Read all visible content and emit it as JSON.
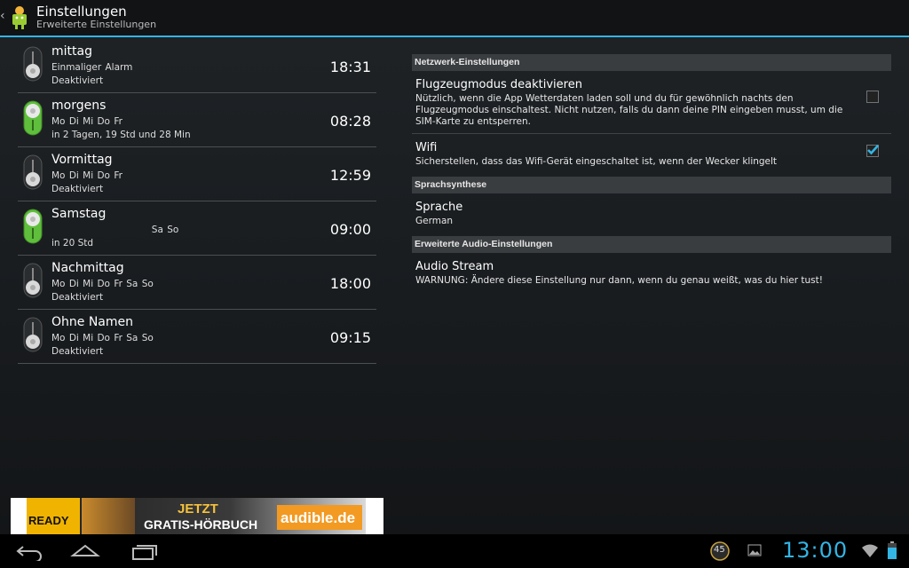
{
  "actionbar": {
    "title": "Einstellungen",
    "subtitle": "Erweiterte Einstellungen"
  },
  "alarms": [
    {
      "name": "mittag",
      "days": "Einmaliger Alarm",
      "status": "Deaktiviert",
      "time": "18:31",
      "enabled": false
    },
    {
      "name": "morgens",
      "days": "Mo Di Mi Do Fr",
      "status": "in 2 Tagen, 19 Std und 28 Min",
      "time": "08:28",
      "enabled": true
    },
    {
      "name": "Vormittag",
      "days": "Mo Di Mi Do Fr",
      "status": "Deaktiviert",
      "time": "12:59",
      "enabled": false
    },
    {
      "name": "Samstag",
      "days": "                          Sa So",
      "status": "in 20 Std",
      "time": "09:00",
      "enabled": true
    },
    {
      "name": "Nachmittag",
      "days": "Mo Di Mi Do Fr Sa So",
      "status": "Deaktiviert",
      "time": "18:00",
      "enabled": false
    },
    {
      "name": "Ohne Namen",
      "days": "Mo Di Mi Do Fr Sa So",
      "status": "Deaktiviert",
      "time": "09:15",
      "enabled": false
    }
  ],
  "ad": {
    "ready": "READY",
    "jetzt": "JETZT",
    "gratis": "GRATIS-HÖRBUCH",
    "brand": "audible.de"
  },
  "settings": {
    "network_header": "Netzwerk-Einstellungen",
    "airplane_title": "Flugzeugmodus deaktivieren",
    "airplane_summary": "Nützlich, wenn die App Wetterdaten laden soll und du für gewöhnlich nachts den Flugzeugmodus einschaltest. Nicht nutzen, falls du dann deine PIN eingeben musst, um die SIM-Karte zu entsperren.",
    "airplane_checked": false,
    "wifi_title": "Wifi",
    "wifi_summary": "Sicherstellen, dass das Wifi-Gerät eingeschaltet ist, wenn der Wecker klingelt",
    "wifi_checked": true,
    "speech_header": "Sprachsynthese",
    "language_title": "Sprache",
    "language_value": "German",
    "audio_header": "Erweiterte Audio-Einstellungen",
    "stream_title": "Audio Stream",
    "stream_summary": "WARNUNG: Ändere diese Einstellung nur dann, wenn du genau weißt, was du hier tust!"
  },
  "sysbar": {
    "clock": "13:00",
    "notification_count": "45"
  },
  "colors": {
    "accent": "#33b5e5",
    "toggle_on": "#5fbf3c",
    "toggle_off": "#d9d9d9"
  }
}
